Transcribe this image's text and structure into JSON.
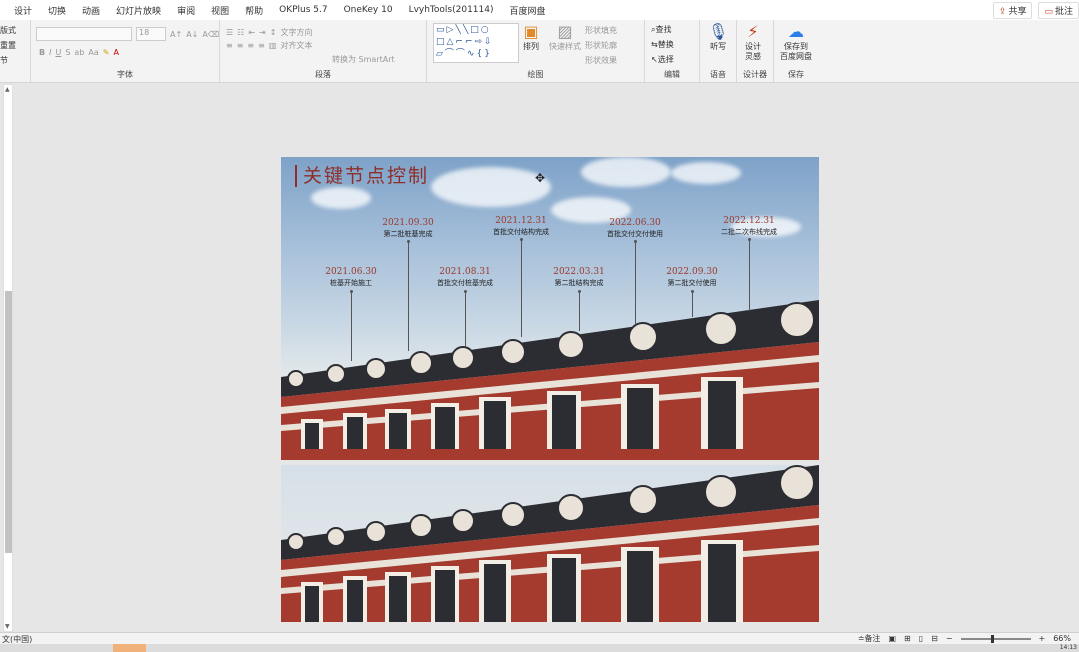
{
  "menu": {
    "tabs": [
      "设计",
      "切换",
      "动画",
      "幻灯片放映",
      "审阅",
      "视图",
      "帮助",
      "OKPlus 5.7",
      "OneKey 10",
      "LvyhTools(201114)",
      "百度网盘"
    ],
    "share": "共享",
    "comment": "批注"
  },
  "ribbon": {
    "left_edge": [
      "版式",
      "重置",
      "节"
    ],
    "font_group": "字体",
    "font_size": "18",
    "paragraph_group": "段落",
    "text_direction": "文字方向",
    "align_text": "对齐文本",
    "smartart": "转换为 SmartArt",
    "drawing_group": "绘图",
    "arrange": "排列",
    "quick_styles": "快速样式",
    "shape_fill": "形状填充",
    "shape_outline": "形状轮廓",
    "shape_effects": "形状效果",
    "editing_group": "编辑",
    "find": "查找",
    "replace": "替换",
    "select": "选择",
    "voice_group": "语音",
    "dictate": "听写",
    "designer_group": "设计器",
    "design_ideas": "设计\n灵感",
    "save_group": "保存",
    "save_baidu": "保存到\n百度网盘"
  },
  "slide": {
    "title": "关键节点控制",
    "top_nodes": [
      {
        "date": "2021.09.30",
        "text": "第二批桩基完成"
      },
      {
        "date": "2021.12.31",
        "text": "首批交付结构完成"
      },
      {
        "date": "2022.06.30",
        "text": "首批交付交付使用"
      },
      {
        "date": "2022.12.31",
        "text": "二批二次布线完成"
      }
    ],
    "bottom_nodes": [
      {
        "date": "2021.06.30",
        "text": "桩基开始施工"
      },
      {
        "date": "2021.08.31",
        "text": "首批交付桩基完成"
      },
      {
        "date": "2022.03.31",
        "text": "第二批结构完成"
      },
      {
        "date": "2022.09.30",
        "text": "第二批交付使用"
      }
    ]
  },
  "status": {
    "language": "文(中国)",
    "notes": "备注",
    "zoom": "66%",
    "clock": "14:13"
  },
  "colors": {
    "accent": "#8e2e2a",
    "building": "#a53a2e"
  }
}
